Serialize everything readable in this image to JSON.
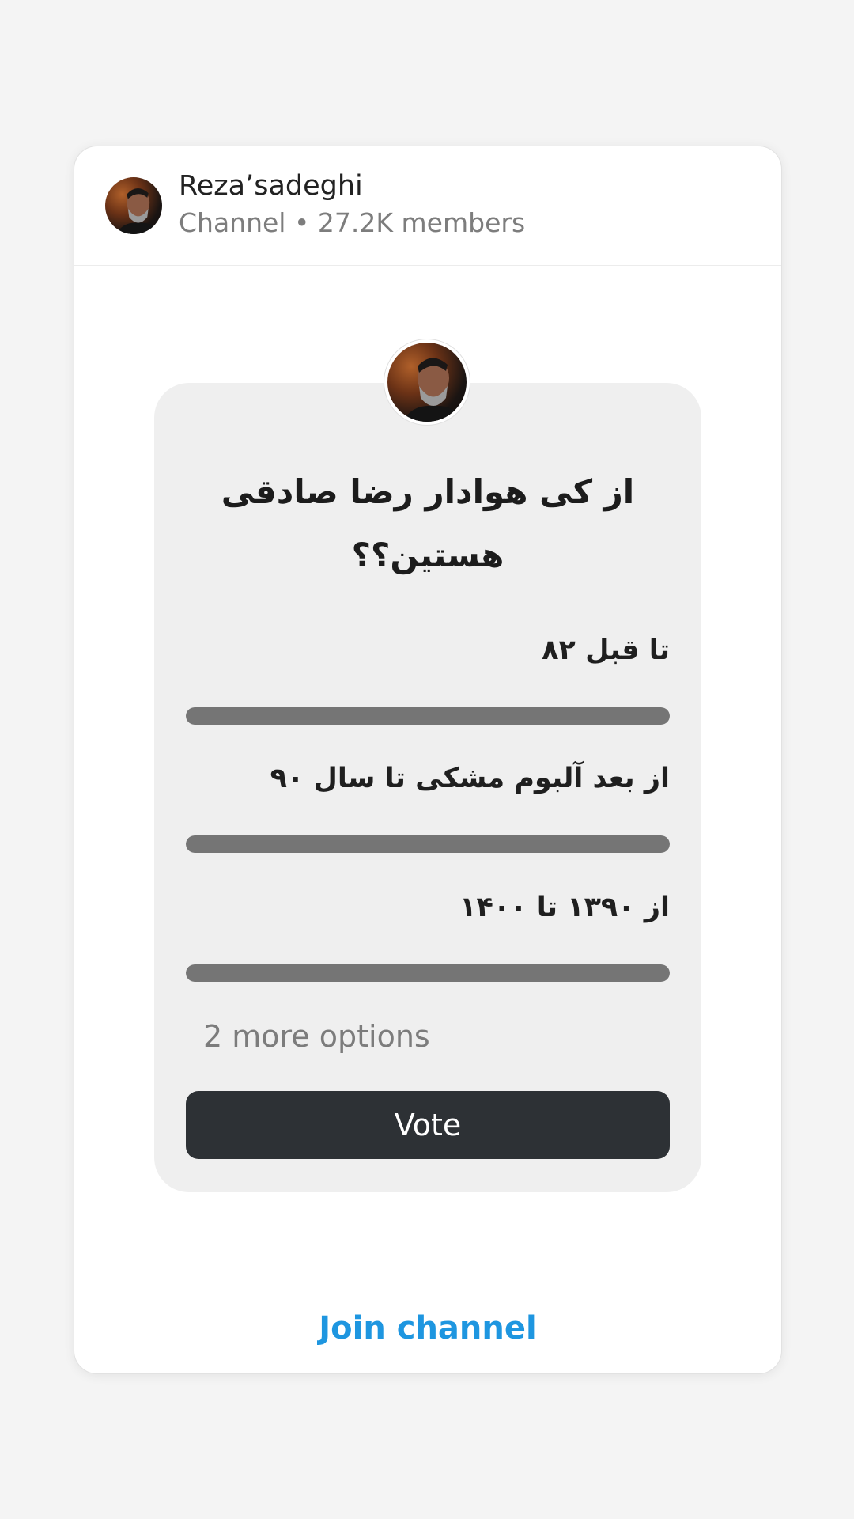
{
  "channel": {
    "name": "Reza’sadeghi",
    "meta": "Channel • 27.2K members"
  },
  "poll": {
    "question": "از کی هوادار رضا صادقی هستین؟؟",
    "options": [
      {
        "label": "تا قبل ۸۲",
        "fill": 1.0
      },
      {
        "label": "از بعد آلبوم مشکی تا سال ۹۰",
        "fill": 1.0
      },
      {
        "label": "از ۱۳۹۰ تا ۱۴۰۰",
        "fill": 1.0
      }
    ],
    "more_options": "2 more options",
    "vote_label": "Vote"
  },
  "footer": {
    "join_label": "Join channel"
  },
  "colors": {
    "accent": "#1e96e0",
    "vote_button": "#2d3135",
    "bar_fill": "#757575"
  },
  "icons": {
    "avatar": "channel-avatar-photo"
  }
}
